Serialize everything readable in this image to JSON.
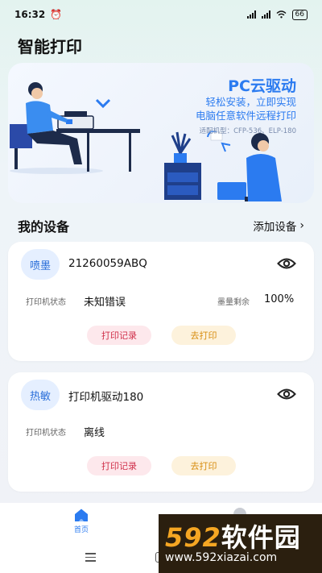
{
  "status": {
    "time": "16:32",
    "battery": "66"
  },
  "page": {
    "title": "智能打印"
  },
  "banner": {
    "title": "PC云驱动",
    "line1": "轻松安装，立即实现",
    "line2": "电脑任意软件远程打印",
    "models": "适配机型：CFP-536、ELP-180"
  },
  "section": {
    "title": "我的设备",
    "add_label": "添加设备"
  },
  "devices": [
    {
      "type": "喷墨",
      "name": "21260059ABQ",
      "status_label": "打印机状态",
      "status_value": "未知错误",
      "ink_label": "墨量剩余",
      "ink_value": "100%",
      "record_label": "打印记录",
      "print_label": "去打印"
    },
    {
      "type": "热敏",
      "name": "打印机驱动180",
      "status_label": "打印机状态",
      "status_value": "离线",
      "record_label": "打印记录",
      "print_label": "去打印"
    }
  ],
  "tabbar": {
    "home_label": "首页"
  },
  "watermark": {
    "brand_num": "592",
    "brand_text": "软件园",
    "url": "www.592xiazai.com"
  },
  "colors": {
    "accent": "#2b7bf0",
    "record": "#d0304a",
    "print": "#d88d10"
  }
}
